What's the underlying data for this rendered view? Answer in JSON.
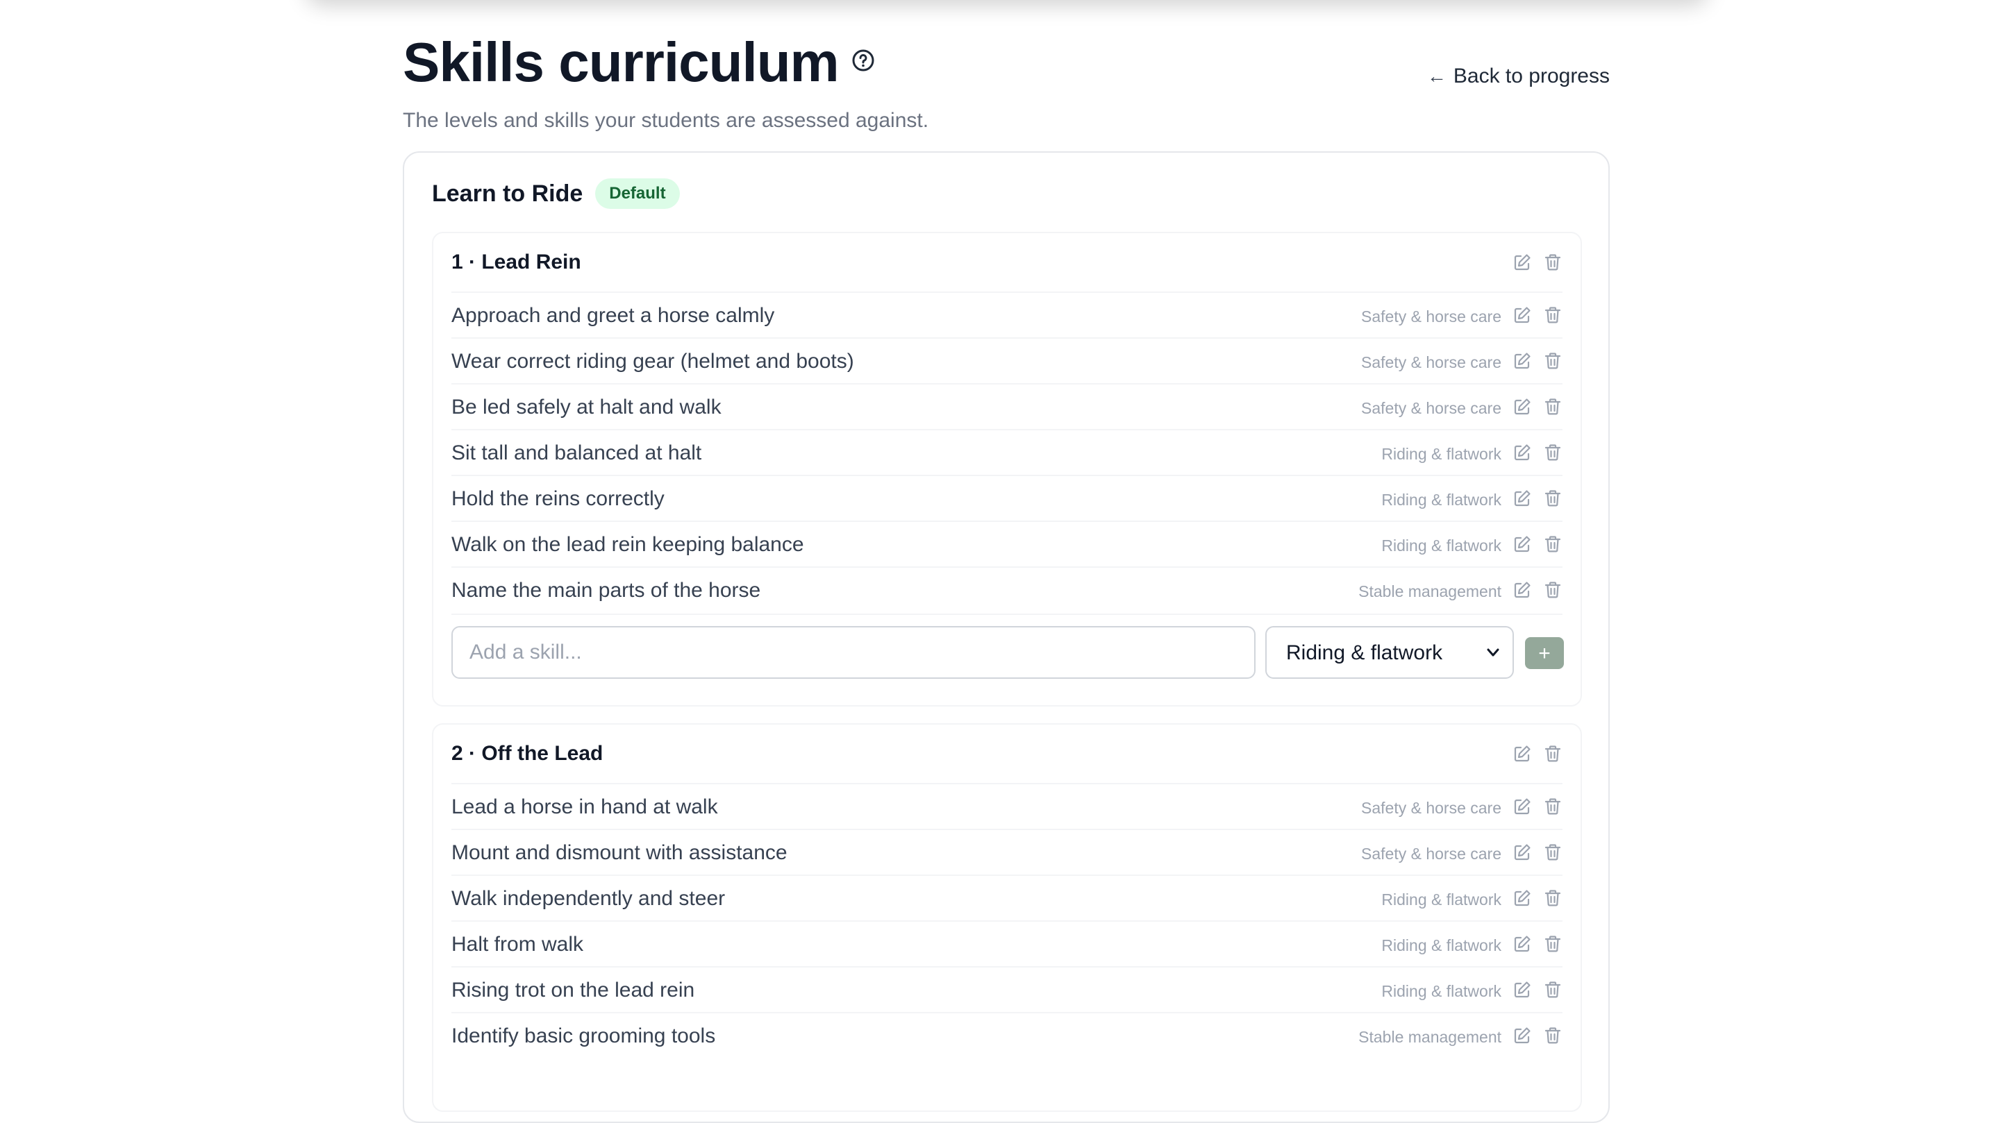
{
  "page": {
    "title": "Skills curriculum",
    "subtitle": "The levels and skills your students are assessed against.",
    "back_link": "Back to progress"
  },
  "curriculum": {
    "name": "Learn to Ride",
    "badge": "Default"
  },
  "levels": [
    {
      "name": "1 · Lead Rein",
      "skills": [
        {
          "name": "Approach and greet a horse calmly",
          "category": "Safety & horse care"
        },
        {
          "name": "Wear correct riding gear (helmet and boots)",
          "category": "Safety & horse care"
        },
        {
          "name": "Be led safely at halt and walk",
          "category": "Safety & horse care"
        },
        {
          "name": "Sit tall and balanced at halt",
          "category": "Riding & flatwork"
        },
        {
          "name": "Hold the reins correctly",
          "category": "Riding & flatwork"
        },
        {
          "name": "Walk on the lead rein keeping balance",
          "category": "Riding & flatwork"
        },
        {
          "name": "Name the main parts of the horse",
          "category": "Stable management"
        }
      ],
      "add_skill": {
        "placeholder": "Add a skill...",
        "selected_category": "Riding & flatwork",
        "button_label": "+"
      }
    },
    {
      "name": "2 · Off the Lead",
      "skills": [
        {
          "name": "Lead a horse in hand at walk",
          "category": "Safety & horse care"
        },
        {
          "name": "Mount and dismount with assistance",
          "category": "Safety & horse care"
        },
        {
          "name": "Walk independently and steer",
          "category": "Riding & flatwork"
        },
        {
          "name": "Halt from walk",
          "category": "Riding & flatwork"
        },
        {
          "name": "Rising trot on the lead rein",
          "category": "Riding & flatwork"
        },
        {
          "name": "Identify basic grooming tools",
          "category": "Stable management"
        }
      ]
    }
  ],
  "icons": {
    "help": "question-circle-icon",
    "back": "arrow-left-icon",
    "edit": "edit-icon",
    "delete": "trash-icon"
  },
  "colors": {
    "badge_bg": "#dcfce7",
    "badge_text": "#166534",
    "add_button": "#94a89a"
  }
}
